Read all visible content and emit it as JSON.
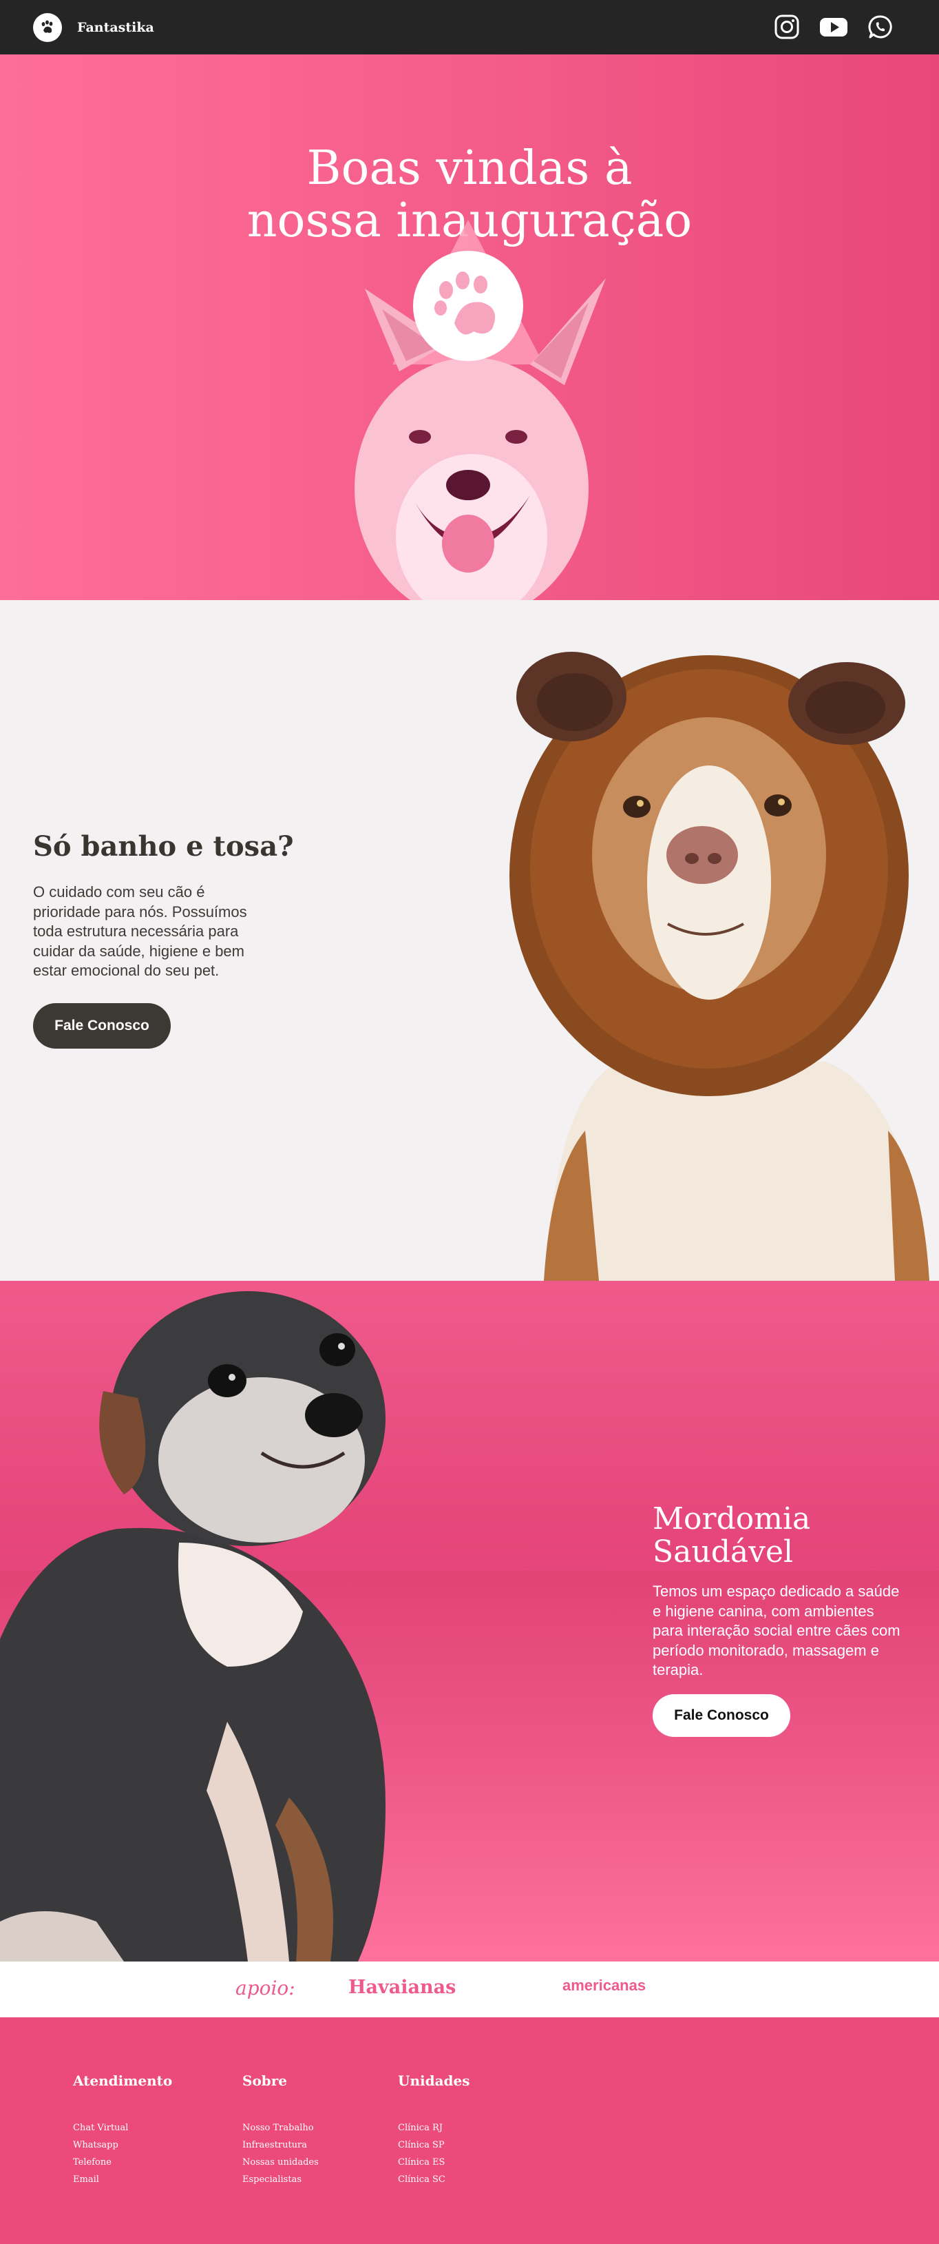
{
  "header": {
    "brand": "Fantastika",
    "social_icons": [
      "instagram-icon",
      "youtube-icon",
      "whatsapp-icon"
    ]
  },
  "hero": {
    "title_line1": "Boas vindas à",
    "title_line2": "nossa inauguração"
  },
  "section_grooming": {
    "title": "Só banho e tosa?",
    "text": "O cuidado com seu cão é prioridade para nós. Possuímos toda estrutura necessária para cuidar da saúde, higiene e bem estar emocional do seu pet.",
    "button": "Fale Conosco"
  },
  "section_wellness": {
    "title_line1": "Mordomia",
    "title_line2": "Saudável",
    "text": "Temos um espaço dedicado a saúde e higiene canina, com ambientes para interação social entre cães com período monitorado, massagem e terapia.",
    "button": "Fale Conosco"
  },
  "sponsors": {
    "label": "apoio:",
    "brands": [
      "Havaianas",
      "americanas"
    ]
  },
  "footer": {
    "columns": [
      {
        "title": "Atendimento",
        "links": [
          "Chat Virtual",
          "Whatsapp",
          "Telefone",
          "Email"
        ]
      },
      {
        "title": "Sobre",
        "links": [
          "Nosso Trabalho",
          "Infraestrutura",
          "Nossas unidades",
          "Especialistas"
        ]
      },
      {
        "title": "Unidades",
        "links": [
          "Clínica RJ",
          "Clínica SP",
          "Clínica ES",
          "Clínica SC"
        ]
      }
    ]
  },
  "colors": {
    "header_bg": "#252525",
    "pink_accent": "#ee5a8c",
    "footer_bg": "#ec4a7a",
    "light_bg": "#f3f1f1",
    "dark_button": "#3c3833"
  }
}
